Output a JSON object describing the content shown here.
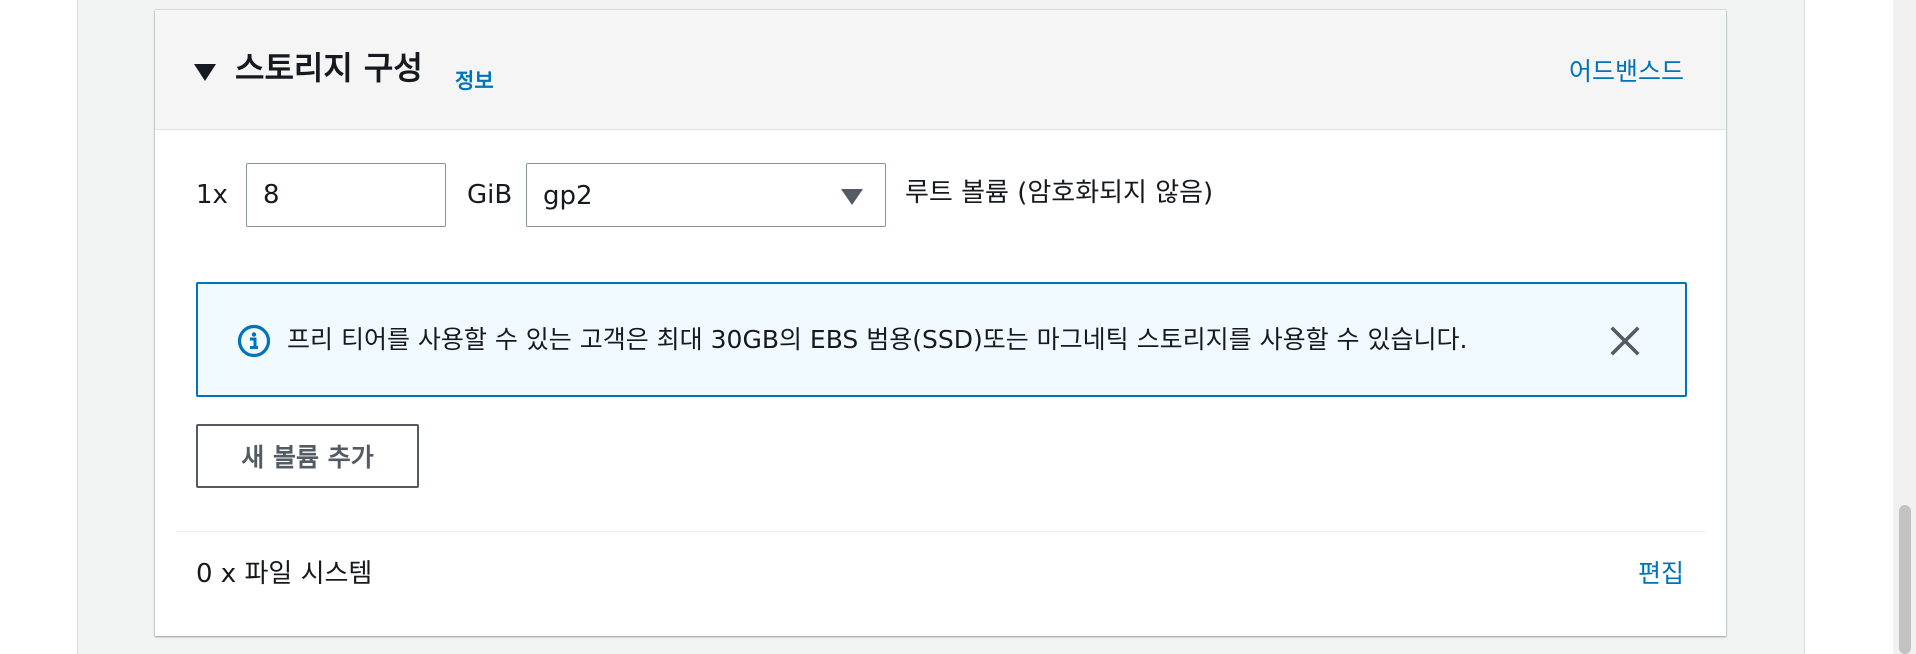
{
  "panel": {
    "title": "스토리지 구성",
    "info_link": "정보",
    "advanced_link": "어드밴스드"
  },
  "volume_row": {
    "multiplier": "1x",
    "size_value": "8",
    "unit": "GiB",
    "volume_type": "gp2",
    "root_label": "루트 볼륨  (암호화되지 않음)"
  },
  "alert": {
    "message": "프리 티어를 사용할 수 있는 고객은 최대 30GB의 EBS 범용(SSD)또는 마그네틱 스토리지를 사용할 수 있습니다.",
    "icon": "info-icon",
    "close_icon": "close-icon"
  },
  "add_volume_button": "새 볼륨 추가",
  "file_systems": {
    "label": "0 x 파일 시스템",
    "edit_link": "편집"
  },
  "colors": {
    "link": "#0073bb",
    "alert_border": "#0073bb",
    "alert_background": "#f1faff",
    "header_background": "#f5f5f5",
    "page_background": "#f2f3f3"
  }
}
